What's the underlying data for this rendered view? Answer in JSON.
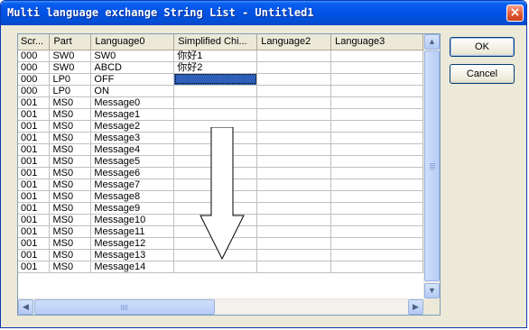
{
  "window": {
    "title": "Multi language exchange String List - Untitled1",
    "close_label": "×"
  },
  "table": {
    "headers": [
      "Scr...",
      "Part",
      "Language0",
      "Simplified Chi...",
      "Language2",
      "Language3"
    ],
    "rows": [
      [
        "000",
        "SW0",
        "SW0",
        "你好1",
        "",
        ""
      ],
      [
        "000",
        "SW0",
        "ABCD",
        "你好2",
        "",
        ""
      ],
      [
        "000",
        "LP0",
        "OFF",
        "",
        "",
        ""
      ],
      [
        "000",
        "LP0",
        "ON",
        "",
        "",
        ""
      ],
      [
        "001",
        "MS0",
        "Message0",
        "",
        "",
        ""
      ],
      [
        "001",
        "MS0",
        "Message1",
        "",
        "",
        ""
      ],
      [
        "001",
        "MS0",
        "Message2",
        "",
        "",
        ""
      ],
      [
        "001",
        "MS0",
        "Message3",
        "",
        "",
        ""
      ],
      [
        "001",
        "MS0",
        "Message4",
        "",
        "",
        ""
      ],
      [
        "001",
        "MS0",
        "Message5",
        "",
        "",
        ""
      ],
      [
        "001",
        "MS0",
        "Message6",
        "",
        "",
        ""
      ],
      [
        "001",
        "MS0",
        "Message7",
        "",
        "",
        ""
      ],
      [
        "001",
        "MS0",
        "Message8",
        "",
        "",
        ""
      ],
      [
        "001",
        "MS0",
        "Message9",
        "",
        "",
        ""
      ],
      [
        "001",
        "MS0",
        "Message10",
        "",
        "",
        ""
      ],
      [
        "001",
        "MS0",
        "Message11",
        "",
        "",
        ""
      ],
      [
        "001",
        "MS0",
        "Message12",
        "",
        "",
        ""
      ],
      [
        "001",
        "MS0",
        "Message13",
        "",
        "",
        ""
      ],
      [
        "001",
        "MS0",
        "Message14",
        "",
        "",
        ""
      ]
    ],
    "selected_cell": {
      "row": 2,
      "col": 3
    }
  },
  "scroll": {
    "up": "▲",
    "down": "▼",
    "left": "◀",
    "right": "▶"
  },
  "buttons": {
    "ok": "OK",
    "cancel": "Cancel"
  },
  "annotation": {
    "icon": "down-arrow-icon"
  }
}
